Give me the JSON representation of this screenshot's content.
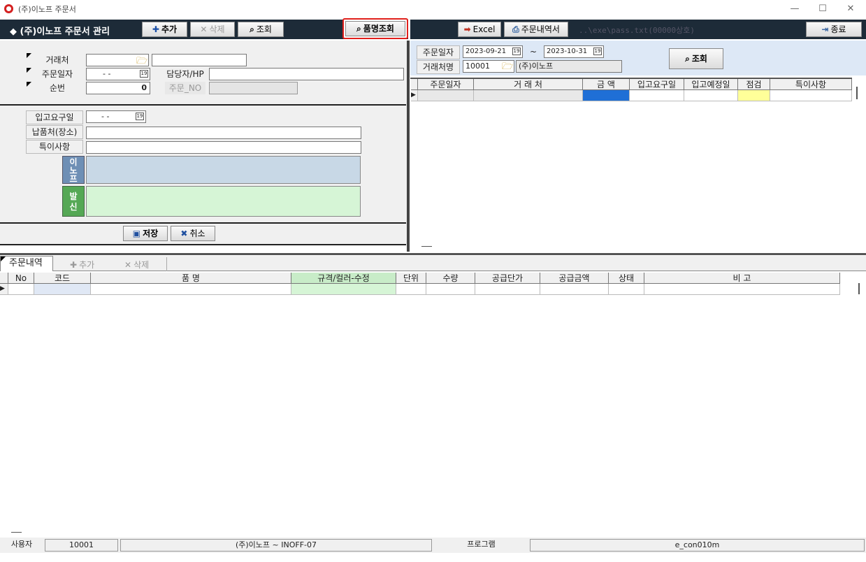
{
  "window": {
    "title": "(주)이노프 주문서",
    "minimize": "—",
    "maximize": "☐",
    "close": "✕"
  },
  "header": {
    "title": "◆ (주)이노프 주문서 관리",
    "add_label": "추가",
    "delete_label": "삭제",
    "search_label": "조회",
    "item_search_label": "품명조회",
    "excel_label": "Excel",
    "order_history_label": "주문내역서",
    "path_text": "..\\exe\\pass.txt(00000상호)",
    "exit_label": "종료"
  },
  "form": {
    "client_label": "거래처",
    "client_code": "",
    "client_name": "",
    "order_date_label": "주문일자",
    "order_date_value": "-  -",
    "manager_label": "담당자/HP",
    "manager_value": "",
    "seq_label": "순번",
    "seq_value": "0",
    "order_no_label": "주문_NO",
    "order_no_value": "",
    "stock_req_label": "입고요구일",
    "stock_req_value": "-  -",
    "delivery_label": "납품처(장소)",
    "delivery_value": "",
    "remarks_label": "특이사항",
    "remarks_value": "",
    "inof_label": "이노프",
    "send_label": "발신",
    "save_label": "저장",
    "cancel_label": "취소"
  },
  "search": {
    "date_label": "주문일자",
    "date_from": "2023-09-21",
    "tilde": "~",
    "date_to": "2023-10-31",
    "client_label": "거래처명",
    "client_code": "10001",
    "client_name": "(주)이노프",
    "search_label": "조회"
  },
  "order_grid": {
    "columns": [
      "주문일자",
      "거 래 처",
      "금 액",
      "입고요구일",
      "입고예정일",
      "점검",
      "특이사항"
    ]
  },
  "detail": {
    "tab_label": "주문내역",
    "add_label": "추가",
    "delete_label": "삭제",
    "columns": [
      "No",
      "코드",
      "품 명",
      "규격/컬러-수정",
      "단위",
      "수량",
      "공급단가",
      "공급금액",
      "상태",
      "비 고"
    ]
  },
  "statusbar": {
    "user_label": "사용자",
    "user_value": "10001",
    "company": "(주)이노프 ~ INOFF-07",
    "program_label": "프로그램",
    "program_value": "e_con010m"
  },
  "colors": {
    "header_bg": "#1d2b38",
    "highlight_border": "#e0201c",
    "inof_bg": "#c8d8e6",
    "send_bg": "#d6f5d6",
    "amount_cell": "#1f6fd6",
    "check_cell": "#ffff99",
    "spec_header": "#c8ecc8",
    "code_cell": "#e0e8f5"
  }
}
